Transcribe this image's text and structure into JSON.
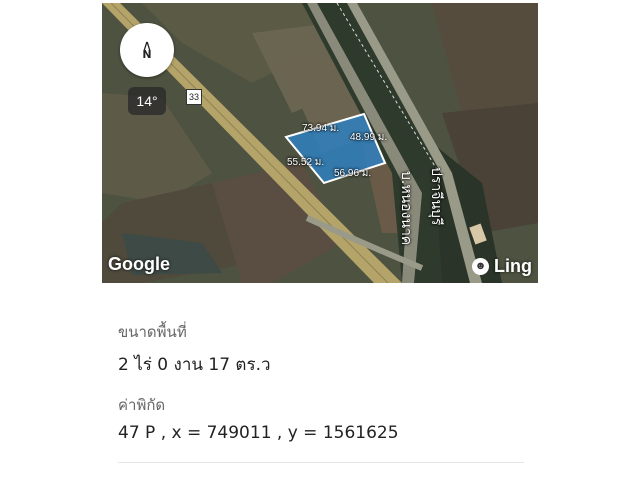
{
  "map": {
    "compass_letter": "N",
    "compass_arrow": "∧",
    "tilt": "14°",
    "route_number": "33",
    "measurements": [
      "73.94 ม.",
      "48.99 ม.",
      "55.52 ม.",
      "56.96 ม."
    ],
    "road_labels": [
      "บ.หนองนาค",
      "ปราจีนบุรี"
    ],
    "google_label": "Google",
    "ling_label": "Ling",
    "ling_logo": "☻",
    "plot_color": "#2f80c0"
  },
  "details": {
    "area_label": "ขนาดพื้นที่",
    "area_value": "2 ไร่ 0 งาน 17 ตร.ว",
    "coord_label": "ค่าพิกัด",
    "coord_value": "47 P , x = 749011 , y = 1561625"
  }
}
